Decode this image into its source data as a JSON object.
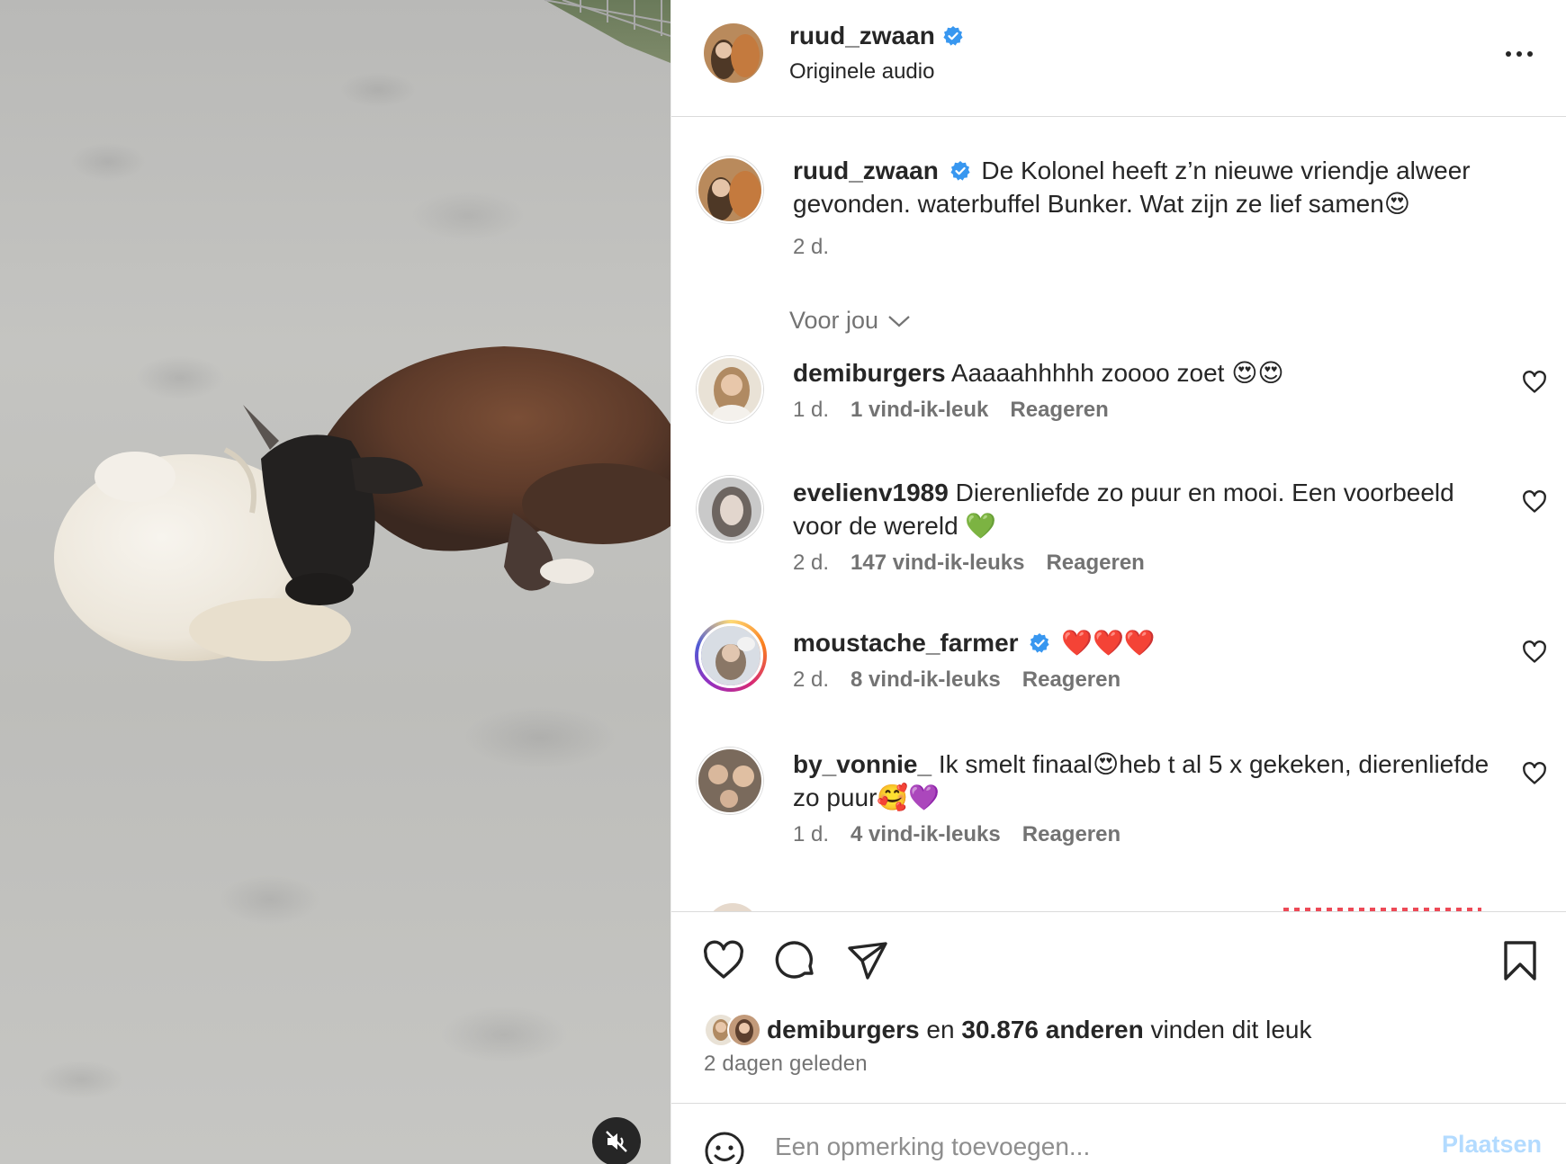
{
  "post": {
    "author": "ruud_zwaan",
    "audio": "Originele audio",
    "caption": "De Kolonel heeft z’n nieuwe vriendje alweer gevonden. waterbuffel Bunker. Wat zijn ze lief samen😍",
    "caption_time": "2 d.",
    "author_verified": true
  },
  "comments_filter": "Voor jou",
  "comments": [
    {
      "user": "demiburgers",
      "verified": false,
      "text": "Aaaaahhhhh zoooo zoet 😍😍",
      "time": "1 d.",
      "likes": "1 vind-ik-leuk",
      "reply": "Reageren"
    },
    {
      "user": "evelienv1989",
      "verified": false,
      "text": "Dierenliefde zo puur en mooi. Een voorbeeld voor de wereld 💚",
      "time": "2 d.",
      "likes": "147 vind-ik-leuks",
      "reply": "Reageren"
    },
    {
      "user": "moustache_farmer",
      "verified": true,
      "text": "❤️❤️❤️",
      "time": "2 d.",
      "likes": "8 vind-ik-leuks",
      "reply": "Reageren"
    },
    {
      "user": "by_vonnie_",
      "verified": false,
      "text": "Ik smelt finaal😍heb t al 5 x gekeken, dierenliefde zo puur🥰💜",
      "time": "1 d.",
      "likes": "4 vind-ik-leuks",
      "reply": "Reageren"
    }
  ],
  "likes_summary": {
    "user": "demiburgers",
    "connector": "en",
    "count": "30.876 anderen",
    "suffix": "vinden dit leuk"
  },
  "post_date": "2 dagen geleden",
  "add_comment": {
    "placeholder": "Een opmerking toevoegen...",
    "post_label": "Plaatsen"
  },
  "colors": {
    "verified": "#3897f0",
    "link_disabled": "#b3dbff",
    "secondary_text": "#737373"
  }
}
